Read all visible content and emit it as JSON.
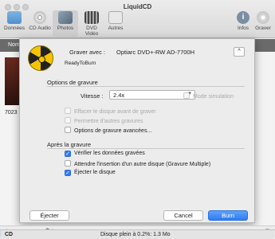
{
  "window": {
    "title": "LiquidCD"
  },
  "toolbar": {
    "items": [
      {
        "label": "Données",
        "icon": "folder-icon"
      },
      {
        "label": "CD Audio",
        "icon": "cd-icon"
      },
      {
        "label": "Photos",
        "icon": "photos-icon"
      },
      {
        "label": "DVD Vidéo",
        "icon": "video-icon"
      },
      {
        "label": "Autres",
        "icon": "document-icon"
      }
    ],
    "info_label": "Infos",
    "burn_label": "Graver"
  },
  "background": {
    "column_header": "Nom",
    "thumb_label": "7023"
  },
  "dialog": {
    "burner_label": "Graver avec :",
    "burner_value": "Optiarc DVD+-RW AD-7700H",
    "status": "ReadyToBurn",
    "collapse_symbol": "^",
    "options_title": "Options de gravure",
    "speed_label": "Vitesse :",
    "speed_value": "2.4x",
    "simulation_label": "Mode simulation",
    "erase_label": "Effacer le disque avant de graver",
    "allow_label": "Permettre d'autres gravures",
    "advanced_label": "Options de gravure avancées...",
    "after_title": "Après la gravure",
    "verify_label": "Vérifier les données gravées",
    "wait_label": "Attendre l'insertion d'un autre disque (Gravure Multiple)",
    "eject_label": "Éjecter le disque",
    "eject_button": "Éjecter",
    "cancel_button": "Cancel",
    "burn_button": "Burn",
    "checkmark": "✓"
  },
  "bottombar": {
    "add_symbol": "+",
    "remove_symbol": "−",
    "gear_symbol": "⚙▾",
    "eye_symbol": "◉"
  },
  "statusbar": {
    "left": "CD",
    "center": "Disque plein à 0.2%: 1.3 Mo",
    "fill_percent": 0.2
  },
  "colors": {
    "accent": "#2f7bf5",
    "header": "#6a6a6a"
  }
}
